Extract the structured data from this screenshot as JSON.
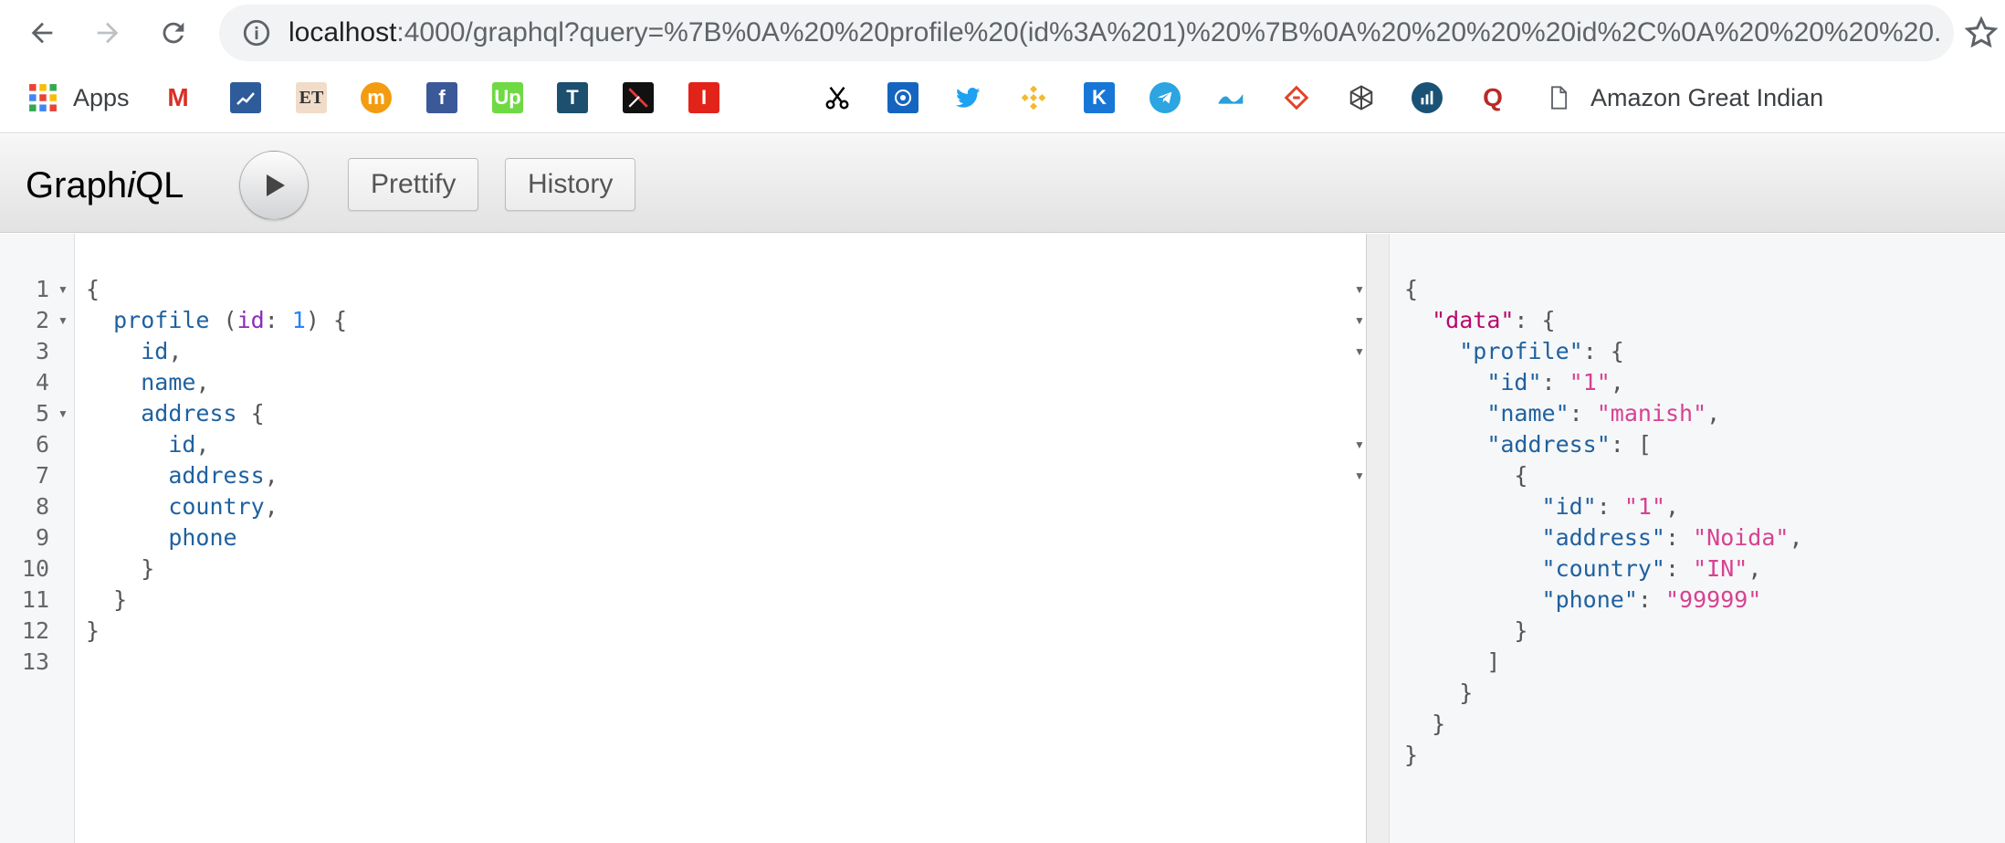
{
  "browser": {
    "url_host": "localhost",
    "url_rest": ":4000/graphql?query=%7B%0A%20%20profile%20(id%3A%201)%20%7B%0A%20%20%20%20id%2C%0A%20%20%20%20...",
    "bookmarks": {
      "apps_label": "Apps",
      "last_label": "Amazon Great Indian",
      "items": [
        {
          "icon": "gmail-icon",
          "glyph": "M",
          "color": "#d93025"
        },
        {
          "icon": "chart-app-icon",
          "glyph": "",
          "color": "#2e5c9a"
        },
        {
          "icon": "economic-times-icon",
          "glyph": "ET",
          "color": "#f0dcc8"
        },
        {
          "icon": "moneycontrol-icon",
          "glyph": "m",
          "color": "#f39c12"
        },
        {
          "icon": "facebook-icon",
          "glyph": "f",
          "color": "#3b5998"
        },
        {
          "icon": "upwork-icon",
          "glyph": "Up",
          "color": "#6fda44"
        },
        {
          "icon": "t-app-icon",
          "glyph": "T",
          "color": "#1d4f6e"
        },
        {
          "icon": "tradingview-icon",
          "glyph": "",
          "color": "#111111"
        },
        {
          "icon": "red-i-icon",
          "glyph": "I",
          "color": "#e2231a"
        },
        {
          "icon": "scissors-icon",
          "glyph": "",
          "color": "#000000"
        },
        {
          "icon": "crypto-a-icon",
          "glyph": "",
          "color": "#1565c0"
        },
        {
          "icon": "twitter-icon",
          "glyph": "",
          "color": "#1da1f2"
        },
        {
          "icon": "binance-icon",
          "glyph": "",
          "color": "#f3ba2f"
        },
        {
          "icon": "kucoin-icon",
          "glyph": "K",
          "color": "#1877d6"
        },
        {
          "icon": "telegram-icon",
          "glyph": "",
          "color": "#2ca5e0"
        },
        {
          "icon": "wave-icon",
          "glyph": "",
          "color": "#2aa0d8"
        },
        {
          "icon": "gitlab-like-icon",
          "glyph": "",
          "color": "#e24329"
        },
        {
          "icon": "cube-icon",
          "glyph": "",
          "color": "#444444"
        },
        {
          "icon": "bar-chart-icon",
          "glyph": "",
          "color": "#1a5276"
        },
        {
          "icon": "quora-icon",
          "glyph": "Q",
          "color": "#b92b27"
        },
        {
          "icon": "page-icon",
          "glyph": "",
          "color": "#5f6368"
        }
      ]
    }
  },
  "toolbar": {
    "title_pre": "Graph",
    "title_i": "i",
    "title_post": "QL",
    "prettify_label": "Prettify",
    "history_label": "History"
  },
  "query_lines": [
    {
      "num": "1",
      "fold": true,
      "tokens": [
        {
          "t": "{",
          "c": "punct"
        }
      ]
    },
    {
      "num": "2",
      "fold": true,
      "tokens": [
        {
          "t": "  ",
          "c": "punct"
        },
        {
          "t": "profile",
          "c": "field"
        },
        {
          "t": " (",
          "c": "punct"
        },
        {
          "t": "id",
          "c": "arg"
        },
        {
          "t": ": ",
          "c": "punct"
        },
        {
          "t": "1",
          "c": "num"
        },
        {
          "t": ") {",
          "c": "punct"
        }
      ]
    },
    {
      "num": "3",
      "fold": false,
      "tokens": [
        {
          "t": "    ",
          "c": "punct"
        },
        {
          "t": "id",
          "c": "field"
        },
        {
          "t": ",",
          "c": "punct"
        }
      ]
    },
    {
      "num": "4",
      "fold": false,
      "tokens": [
        {
          "t": "    ",
          "c": "punct"
        },
        {
          "t": "name",
          "c": "field"
        },
        {
          "t": ",",
          "c": "punct"
        }
      ]
    },
    {
      "num": "5",
      "fold": true,
      "tokens": [
        {
          "t": "    ",
          "c": "punct"
        },
        {
          "t": "address",
          "c": "field"
        },
        {
          "t": " {",
          "c": "punct"
        }
      ]
    },
    {
      "num": "6",
      "fold": false,
      "tokens": [
        {
          "t": "      ",
          "c": "punct"
        },
        {
          "t": "id",
          "c": "field"
        },
        {
          "t": ",",
          "c": "punct"
        }
      ]
    },
    {
      "num": "7",
      "fold": false,
      "tokens": [
        {
          "t": "      ",
          "c": "punct"
        },
        {
          "t": "address",
          "c": "field"
        },
        {
          "t": ",",
          "c": "punct"
        }
      ]
    },
    {
      "num": "8",
      "fold": false,
      "tokens": [
        {
          "t": "      ",
          "c": "punct"
        },
        {
          "t": "country",
          "c": "field"
        },
        {
          "t": ",",
          "c": "punct"
        }
      ]
    },
    {
      "num": "9",
      "fold": false,
      "tokens": [
        {
          "t": "      ",
          "c": "punct"
        },
        {
          "t": "phone",
          "c": "field"
        }
      ]
    },
    {
      "num": "10",
      "fold": false,
      "tokens": [
        {
          "t": "    }",
          "c": "punct"
        }
      ]
    },
    {
      "num": "11",
      "fold": false,
      "tokens": [
        {
          "t": "  }",
          "c": "punct"
        }
      ]
    },
    {
      "num": "12",
      "fold": false,
      "tokens": [
        {
          "t": "}",
          "c": "punct"
        }
      ]
    },
    {
      "num": "13",
      "fold": false,
      "tokens": []
    }
  ],
  "result_lines": [
    {
      "fold": true,
      "tokens": [
        {
          "t": "{",
          "c": "punct"
        }
      ]
    },
    {
      "fold": true,
      "tokens": [
        {
          "t": "  ",
          "c": "punct"
        },
        {
          "t": "\"data\"",
          "c": "key-data"
        },
        {
          "t": ": {",
          "c": "punct"
        }
      ]
    },
    {
      "fold": true,
      "tokens": [
        {
          "t": "    ",
          "c": "punct"
        },
        {
          "t": "\"profile\"",
          "c": "key"
        },
        {
          "t": ": {",
          "c": "punct"
        }
      ]
    },
    {
      "fold": false,
      "tokens": [
        {
          "t": "      ",
          "c": "punct"
        },
        {
          "t": "\"id\"",
          "c": "key"
        },
        {
          "t": ": ",
          "c": "punct"
        },
        {
          "t": "\"1\"",
          "c": "str"
        },
        {
          "t": ",",
          "c": "punct"
        }
      ]
    },
    {
      "fold": false,
      "tokens": [
        {
          "t": "      ",
          "c": "punct"
        },
        {
          "t": "\"name\"",
          "c": "key"
        },
        {
          "t": ": ",
          "c": "punct"
        },
        {
          "t": "\"manish\"",
          "c": "str"
        },
        {
          "t": ",",
          "c": "punct"
        }
      ]
    },
    {
      "fold": true,
      "tokens": [
        {
          "t": "      ",
          "c": "punct"
        },
        {
          "t": "\"address\"",
          "c": "key"
        },
        {
          "t": ": [",
          "c": "punct"
        }
      ]
    },
    {
      "fold": true,
      "tokens": [
        {
          "t": "        {",
          "c": "punct"
        }
      ]
    },
    {
      "fold": false,
      "tokens": [
        {
          "t": "          ",
          "c": "punct"
        },
        {
          "t": "\"id\"",
          "c": "key"
        },
        {
          "t": ": ",
          "c": "punct"
        },
        {
          "t": "\"1\"",
          "c": "str"
        },
        {
          "t": ",",
          "c": "punct"
        }
      ]
    },
    {
      "fold": false,
      "tokens": [
        {
          "t": "          ",
          "c": "punct"
        },
        {
          "t": "\"address\"",
          "c": "key"
        },
        {
          "t": ": ",
          "c": "punct"
        },
        {
          "t": "\"Noida\"",
          "c": "str"
        },
        {
          "t": ",",
          "c": "punct"
        }
      ]
    },
    {
      "fold": false,
      "tokens": [
        {
          "t": "          ",
          "c": "punct"
        },
        {
          "t": "\"country\"",
          "c": "key"
        },
        {
          "t": ": ",
          "c": "punct"
        },
        {
          "t": "\"IN\"",
          "c": "str"
        },
        {
          "t": ",",
          "c": "punct"
        }
      ]
    },
    {
      "fold": false,
      "tokens": [
        {
          "t": "          ",
          "c": "punct"
        },
        {
          "t": "\"phone\"",
          "c": "key"
        },
        {
          "t": ": ",
          "c": "punct"
        },
        {
          "t": "\"99999\"",
          "c": "str"
        }
      ]
    },
    {
      "fold": false,
      "tokens": [
        {
          "t": "        }",
          "c": "punct"
        }
      ]
    },
    {
      "fold": false,
      "tokens": [
        {
          "t": "      ]",
          "c": "punct"
        }
      ]
    },
    {
      "fold": false,
      "tokens": [
        {
          "t": "    }",
          "c": "punct"
        }
      ]
    },
    {
      "fold": false,
      "tokens": [
        {
          "t": "  }",
          "c": "punct"
        }
      ]
    },
    {
      "fold": false,
      "tokens": [
        {
          "t": "}",
          "c": "punct"
        }
      ]
    }
  ],
  "colors": {
    "field": "#1f61a0",
    "arg": "#8b2bb9",
    "number": "#2882f9",
    "json_key_data": "#b8096e",
    "json_string": "#d64292"
  }
}
